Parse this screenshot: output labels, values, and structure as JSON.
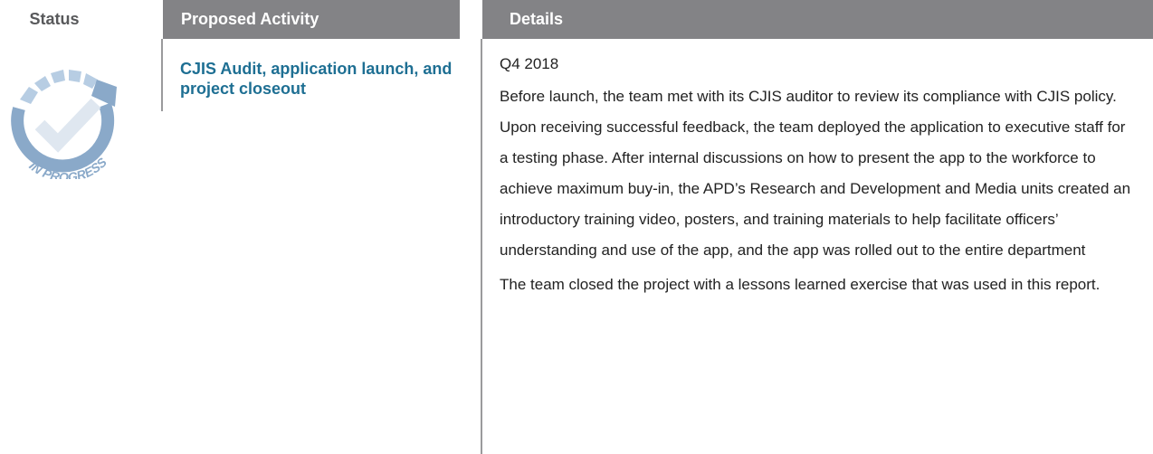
{
  "headers": {
    "status": "Status",
    "activity": "Proposed Activity",
    "details": "Details"
  },
  "status": {
    "icon": "in-progress-check-icon",
    "label": "IN PROGRESS"
  },
  "activity": {
    "title": "CJIS Audit, application launch, and project closeout"
  },
  "details": {
    "date": "Q4 2018",
    "paragraphs": [
      "Before launch, the team met with its CJIS auditor to review its compliance with CJIS policy. Upon receiving successful feedback, the team deployed the application to executive staff for a testing phase. After internal discussions on how to present the app to the workforce to achieve maximum buy-in, the APD’s Research and Development and Media units created an introductory training video, posters, and training materials to help facilitate officers’ understanding and use of the app, and the app was rolled out to the entire department",
      "The team closed the project with a lessons learned exercise that was used in this report."
    ]
  },
  "colors": {
    "header_bg": "#838386",
    "activity_text": "#1e6f93",
    "icon_blue": "#8aa9c9"
  }
}
